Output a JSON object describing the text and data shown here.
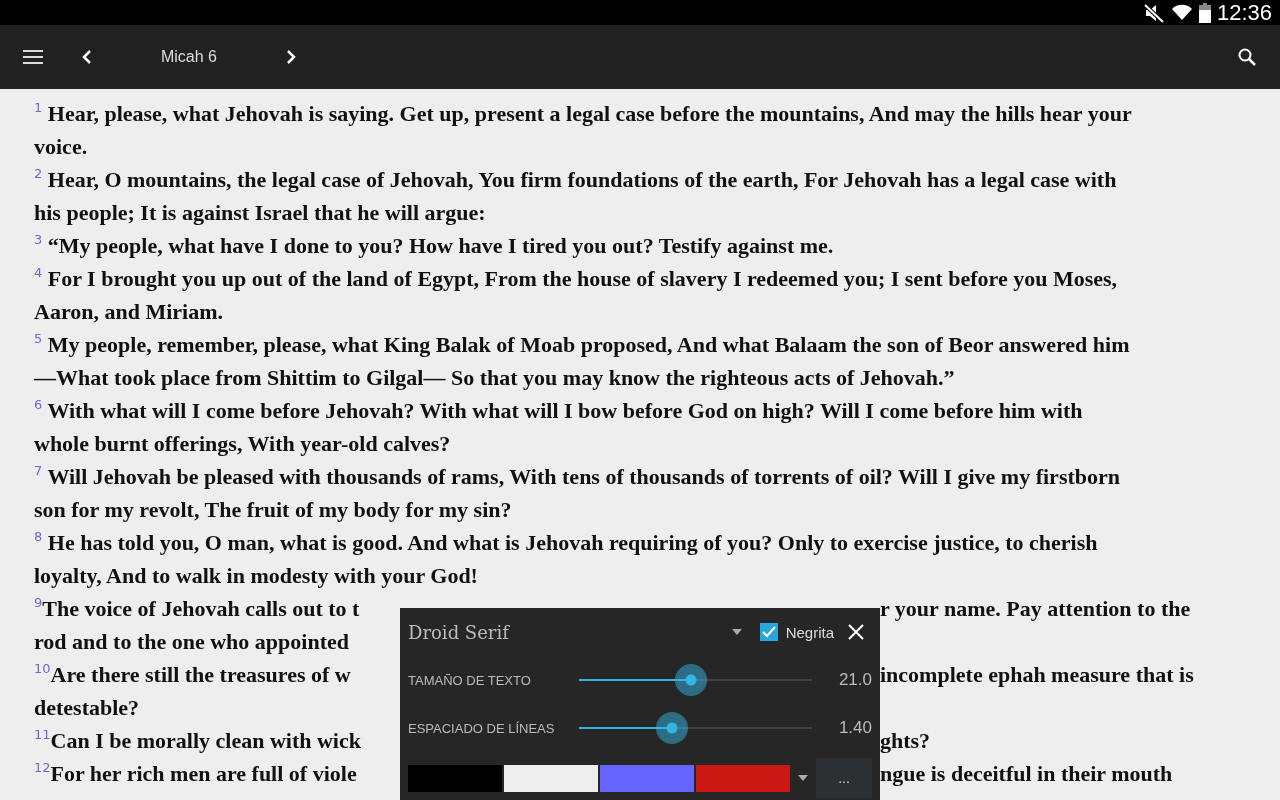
{
  "status_bar": {
    "time": "12:36"
  },
  "toolbar": {
    "title": "Micah 6"
  },
  "verses": [
    {
      "number": "1",
      "text": "Hear, please, what Jehovah is saying. Get up, present a legal case before the mountains, And may the hills hear your voice."
    },
    {
      "number": "2",
      "text": "Hear, O mountains, the legal case of Jehovah, You firm foundations of the earth, For Jehovah has a legal case with his people; It is against Israel that he will argue:"
    },
    {
      "number": "3",
      "text": "“My people, what have I done to you? How have I tired you out? Testify against me."
    },
    {
      "number": "4",
      "text": "For I brought you up out of the land of Egypt, From the house of slavery I redeemed you; I sent before you Moses, Aaron, and Miriam."
    },
    {
      "number": "5",
      "text": "My people, remember, please, what King Balak of Moab proposed, And what Balaam the son of Beor answered him —What took place from Shittim to Gilgal— So that you may know the righteous acts of Jehovah.”"
    },
    {
      "number": "6",
      "text": "With what will I come before Jehovah? With what will I bow before God on high? Will I come before him with whole burnt offerings, With year-old calves?"
    },
    {
      "number": "7",
      "text": "Will Jehovah be pleased with thousands of rams, With tens of thousands of torrents of oil? Will I give my firstborn son for my revolt, The fruit of my body for my sin?"
    },
    {
      "number": "8",
      "text": "He has told you, O man, what is good. And what is Jehovah requiring of you? Only to exercise justice, to cherish loyalty, And to walk in modesty with your God!"
    }
  ],
  "covered_lines": [
    {
      "number": "9",
      "left": "The voice of Jehovah calls out to t",
      "right": "r your name. Pay attention to the"
    },
    {
      "left": "rod and to the one who appointed"
    },
    {
      "number": "10",
      "left": "Are there still the treasures of w",
      "right": "incomplete ephah measure that is"
    },
    {
      "left": "detestable?"
    },
    {
      "number": "11",
      "left": "Can I be morally clean with wick",
      "right": "ghts?"
    },
    {
      "number": "12",
      "left": "For her rich men are full of viole",
      "right": "ngue is deceitful in their mouth"
    }
  ],
  "font_panel": {
    "font": "Droid Serif",
    "bold": {
      "label": "Negrita",
      "checked": true
    },
    "sliders": [
      {
        "label": "TAMAÑO DE TEXTO",
        "level": 0.48,
        "reading": "21.0"
      },
      {
        "label": "ESPACIADO DE LÍNEAS",
        "level": 0.4,
        "reading": "1.40"
      }
    ],
    "swatches": [
      {
        "color": "#000000"
      },
      {
        "color": "#eeeeee"
      },
      {
        "color": "#6666ff"
      },
      {
        "color": "#cc1812"
      }
    ],
    "more_button": "..."
  }
}
